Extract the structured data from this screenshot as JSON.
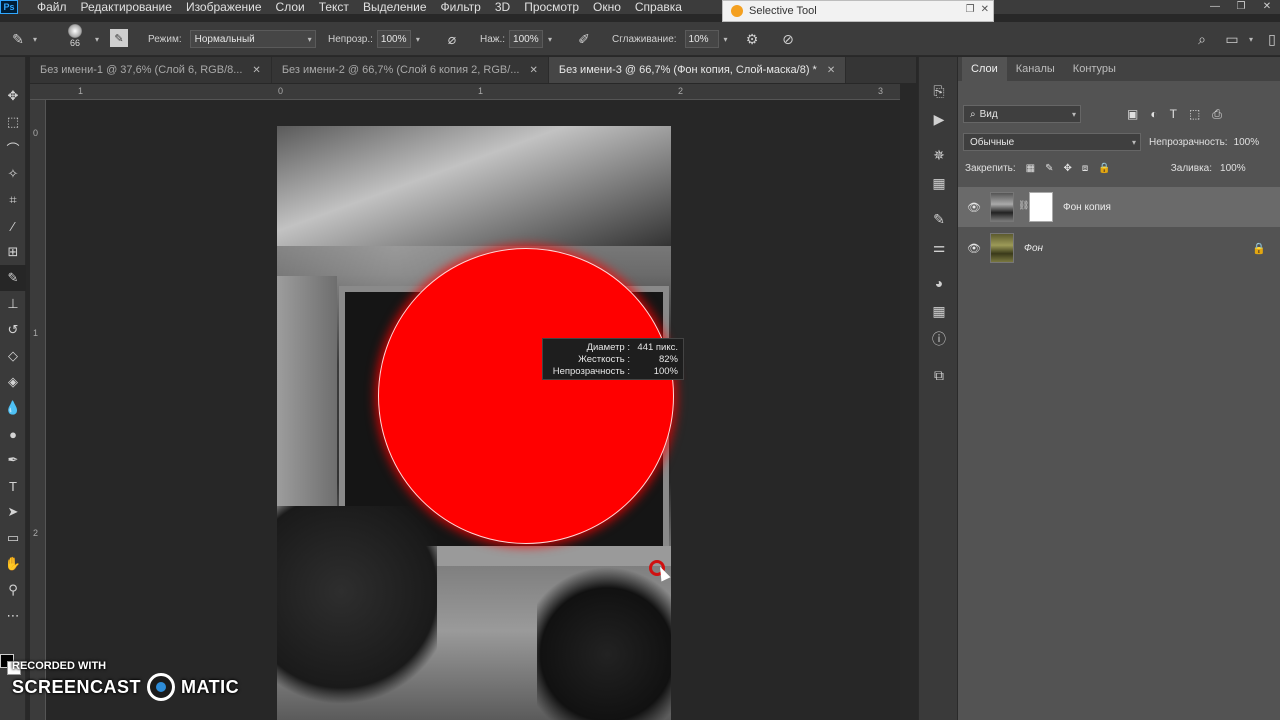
{
  "menubar": {
    "logo": "Ps",
    "items": [
      "Файл",
      "Редактирование",
      "Изображение",
      "Слои",
      "Текст",
      "Выделение",
      "Фильтр",
      "3D",
      "Просмотр",
      "Окно",
      "Справка"
    ]
  },
  "selective_tool": {
    "title": "Selective Tool"
  },
  "options": {
    "brush_size": "66",
    "mode_label": "Режим:",
    "mode_value": "Нормальный",
    "opacity_label": "Непрозр.:",
    "opacity_value": "100%",
    "pressure_label": "Наж.:",
    "pressure_value": "100%",
    "smoothing_label": "Сглаживание:",
    "smoothing_value": "10%"
  },
  "tabs": [
    {
      "label": "Без имени-1 @ 37,6% (Слой 6, RGB/8...",
      "active": false
    },
    {
      "label": "Без имени-2 @ 66,7% (Слой 6 копия 2, RGB/...",
      "active": false
    },
    {
      "label": "Без имени-3 @ 66,7% (Фон копия, Слой-маска/8) *",
      "active": true
    }
  ],
  "ruler": {
    "top": [
      "1",
      "0",
      "1",
      "2",
      "3"
    ],
    "left": [
      "0",
      "1",
      "2"
    ]
  },
  "brush_tooltip": {
    "diameter_label": "Диаметр :",
    "diameter_value": "441 пикс.",
    "hardness_label": "Жесткость :",
    "hardness_value": "82%",
    "opacity_label": "Непрозрачность :",
    "opacity_value": "100%"
  },
  "layers": {
    "tabs": [
      "Слои",
      "Каналы",
      "Контуры"
    ],
    "filter_value": "Вид",
    "blend_mode": "Обычные",
    "opacity_label": "Непрозрачность:",
    "opacity_value": "100%",
    "lock_label": "Закрепить:",
    "fill_label": "Заливка:",
    "fill_value": "100%",
    "items": [
      {
        "name": "Фон копия",
        "selected": true,
        "has_mask": true
      },
      {
        "name": "Фон",
        "selected": false,
        "locked": true
      }
    ]
  },
  "watermark": {
    "line1": "RECORDED WITH",
    "line2a": "SCREENCAST",
    "line2b": "MATIC"
  },
  "colors": {
    "accent": "#31a8ff",
    "brush": "#ff0000"
  }
}
